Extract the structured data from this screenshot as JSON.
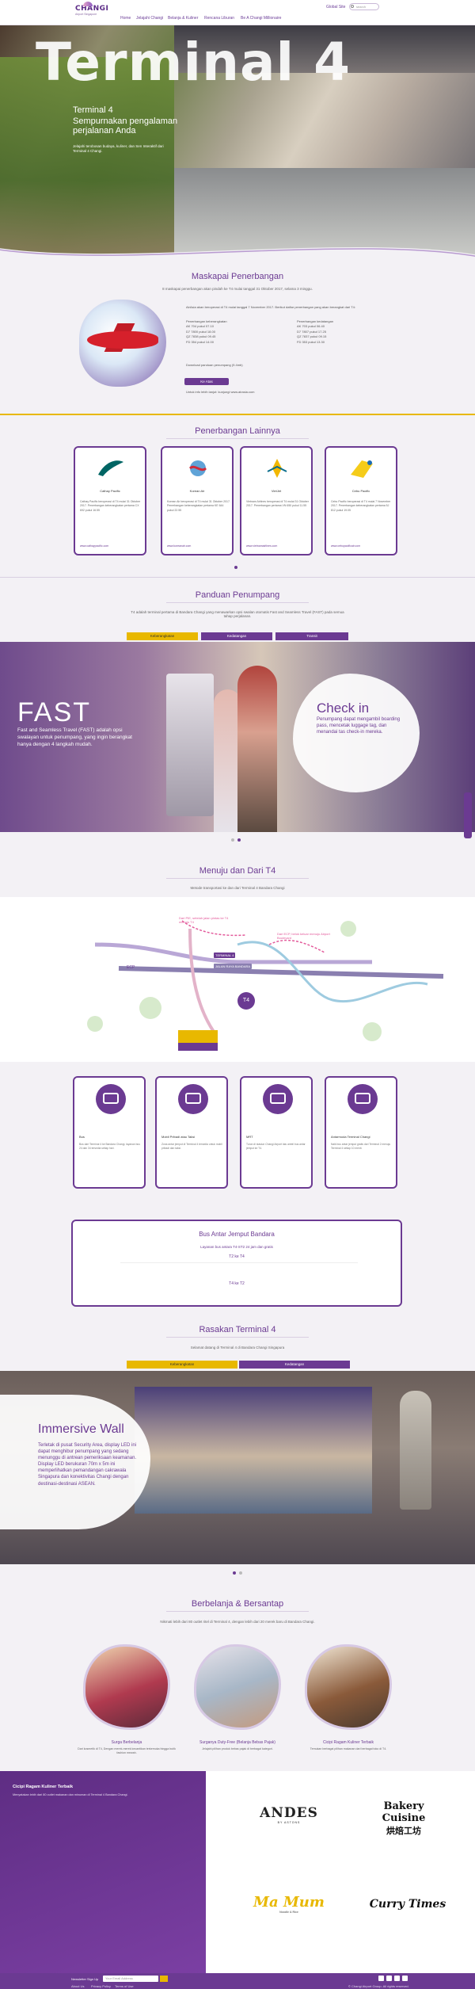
{
  "header": {
    "logo_text": "CHANGI",
    "logo_sub": "Airport Singapore",
    "nav": [
      "Home",
      "Jelajahi Changi",
      "Belanja & Kuliner",
      "Rencana Liburan",
      "Be A Changi Millionaire"
    ],
    "lang": "Global Site",
    "search_placeholder": "search"
  },
  "hero": {
    "title": "Terminal 4",
    "subtitle1": "Terminal 4",
    "subtitle2": "Sempurnakan pengalaman",
    "subtitle3": "perjalanan Anda",
    "desc": "Jelajahi terobosan budaya, kuliner, dan Sen Interaktif dari Terminal 4 Changi."
  },
  "airlines": {
    "title": "Maskapai Penerbangan",
    "intro": "8 maskapai penerbangan akan pindah ke T4 mulai tanggal 31 Oktober 2017, selama 3 minggu.",
    "body": "AirAsia akan beroperasi di T4 mulai tanggal 7 November 2017. Berikut daftar penerbangan yang akan berangkat dari T4:",
    "col1_head": "Penerbangan keberangkatan",
    "col1": [
      "AK 704 pukul 07.10",
      "D7 7800 pukul 18.00",
      "QZ 7838 pukul 09.45",
      "FD 354 pukul 14.00"
    ],
    "col2_head": "Penerbangan kedatangan",
    "col2": [
      "AK 703 pukul 06.40",
      "D7 7807 pukul 17.25",
      "QZ 7837 pukul 09.15",
      "FD 353 pukul 13.30"
    ],
    "download": "Download panduan penumpang (9.4mb)",
    "button": "Ke Atas",
    "more": "Untuk info lebih lanjut: kunjungi www.airasia.com"
  },
  "other_flights": {
    "title": "Penerbangan Lainnya",
    "cards": [
      {
        "name": "Cathay Pacific",
        "text": "Cathay Pacific beroperasi di T4 mulai 31 Oktober 2017. Penerbangan keberangkatan pertama CX 692 pukul 16.55",
        "link": "www.cathaypacific.com"
      },
      {
        "name": "Korean Air",
        "text": "Korean Air beroperasi di T4 mulai 31 Oktober 2017. Penerbangan keberangkatan pertama KE 644 pukul 22.55",
        "link": "www.koreanair.com"
      },
      {
        "name": "VietJet",
        "text": "Vietnam Airlines beroperasi di T4 mulai 31 Oktober 2017. Penerbangan pertama VN 650 pukul 11.55",
        "link": "www.vietnamairlines.com"
      },
      {
        "name": "Cebu Pacific",
        "text": "Cebu Pacific beroperasi di T4 mulai 7 November 2017. Penerbangan keberangkatan pertama 5J 812 pukul 19.05",
        "link": "www.cebupacificair.com"
      }
    ]
  },
  "guide": {
    "title": "Panduan Penumpang",
    "intro": "T4 adalah terminal pertama di Bandara Changi yang menawarkan opsi swalan otomatis Fast and Seamless Travel (FAST) pada semua tahap perjalanan.",
    "tabs": [
      "Keberangkatan",
      "Kedatangan",
      "Transit"
    ],
    "fast_title": "FAST",
    "fast_desc": "Fast and Seamless Travel (FAST) adalah opsi swalayan untuk penumpang, yang ingin berangkat hanya dengan 4 langkah mudah.",
    "checkin_title": "Check in",
    "checkin_desc": "Penumpang dapat mengambil boarding pass, mencetak luggage tag, dan menandai tas check-in mereka."
  },
  "map": {
    "title": "Menuju dan Dari T4",
    "intro": "Metode transportasi ke dan dari Terminal 4 Bandara Changi",
    "labels": [
      "Dari PIE, setelah jalan pintas ke T4 menuju T4",
      "Dari ECP, belok keluar menuju Airport Boulevard",
      "TERMINAL 4",
      "JALAN RAYA BANDARA",
      "ECP",
      "PIE"
    ]
  },
  "transport": {
    "cards": [
      {
        "name": "Bus",
        "text": "Bus dari Terminal 4 ke Bandara Changi, layanan bus 24 dan 34 tersedia setiap hari."
      },
      {
        "name": "Mobil Pribadi atau Taksi",
        "text": "Zona antar jemput di Terminal 4 tersedia untuk mobil pribadi dan taksi."
      },
      {
        "name": "MRT",
        "text": "Turun di stasiun Changi Airport lalu ambil bus antar jemput ke T4."
      },
      {
        "name": "Antarmoda Terminal Changi",
        "text": "Naik bus antar jemput gratis dari Terminal 2 menuju Terminal 4 setiap 10 menit."
      }
    ],
    "bus_title": "Bus Antar Jemput Bandara",
    "bus_sub": "Layanan bus antara T4-ST2 24 jam dan gratis",
    "bus_t2": "T2 ke T4",
    "bus_t4": "T4 ke T2"
  },
  "experience": {
    "title": "Rasakan Terminal 4",
    "intro": "Selamat datang di Terminal 4 di Bandara Changi Singapura",
    "tabs": [
      "Keberangkatan",
      "Kedatangan"
    ],
    "wall_title": "Immersive Wall",
    "wall_desc": "Terletak di pusat Security Area, display LED ini dapat menghibur penumpang yang sedang menunggu di antrean pemeriksaan keamanan. Display LED berukuran 70m x 5m ini memperlihatkan pemandangan cakrawala Singapura dan konektivitas Changi dengan destinasi-destinasi ASEAN."
  },
  "dining": {
    "title": "Berbelanja & Bersantap",
    "intro": "Nikmati lebih dari 80 outlet ritel di Terminal 4, dengan lebih dari 20 merek baru di Bandara Changi.",
    "items": [
      {
        "name": "Surga Berbelanja",
        "text": "Dari kosmetik di T4, Dengan merek-merek kecantikan terkemuka hingga butik fashion mewah."
      },
      {
        "name": "Surganya Duty-Free (Belanja Bebas Pajak)",
        "text": "Jelajahi pilihan produk bebas pajak di berbagai kategori."
      },
      {
        "name": "Cicipi Ragam Kuliner Terbaik",
        "text": "Temukan berbagai pilihan makanan dari berbagai toko di T4."
      }
    ]
  },
  "promo": {
    "title": "Cicipi Ragam Kuliner Terbaik",
    "desc": "Menyatakan lebih dari 80 outlet makanan dan minuman di Terminal 4 Bandara Changi.",
    "brands": [
      "ANDES",
      "Bakery Cuisine",
      "Ma Mum",
      "Curry Times"
    ],
    "brand_subs": [
      "BY ASTONS",
      "烘焙工坊",
      "Noodle & Rice",
      ""
    ]
  },
  "footer": {
    "newsletter_label": "Newsletter Sign Up",
    "email_placeholder": "Your Email Address",
    "links": [
      "About Us",
      "Privacy Policy",
      "Terms of Use"
    ],
    "copyright": "© Changi Airport Group. All rights reserved."
  },
  "colors": {
    "primary": "#6b3a92",
    "accent": "#e8b800"
  }
}
